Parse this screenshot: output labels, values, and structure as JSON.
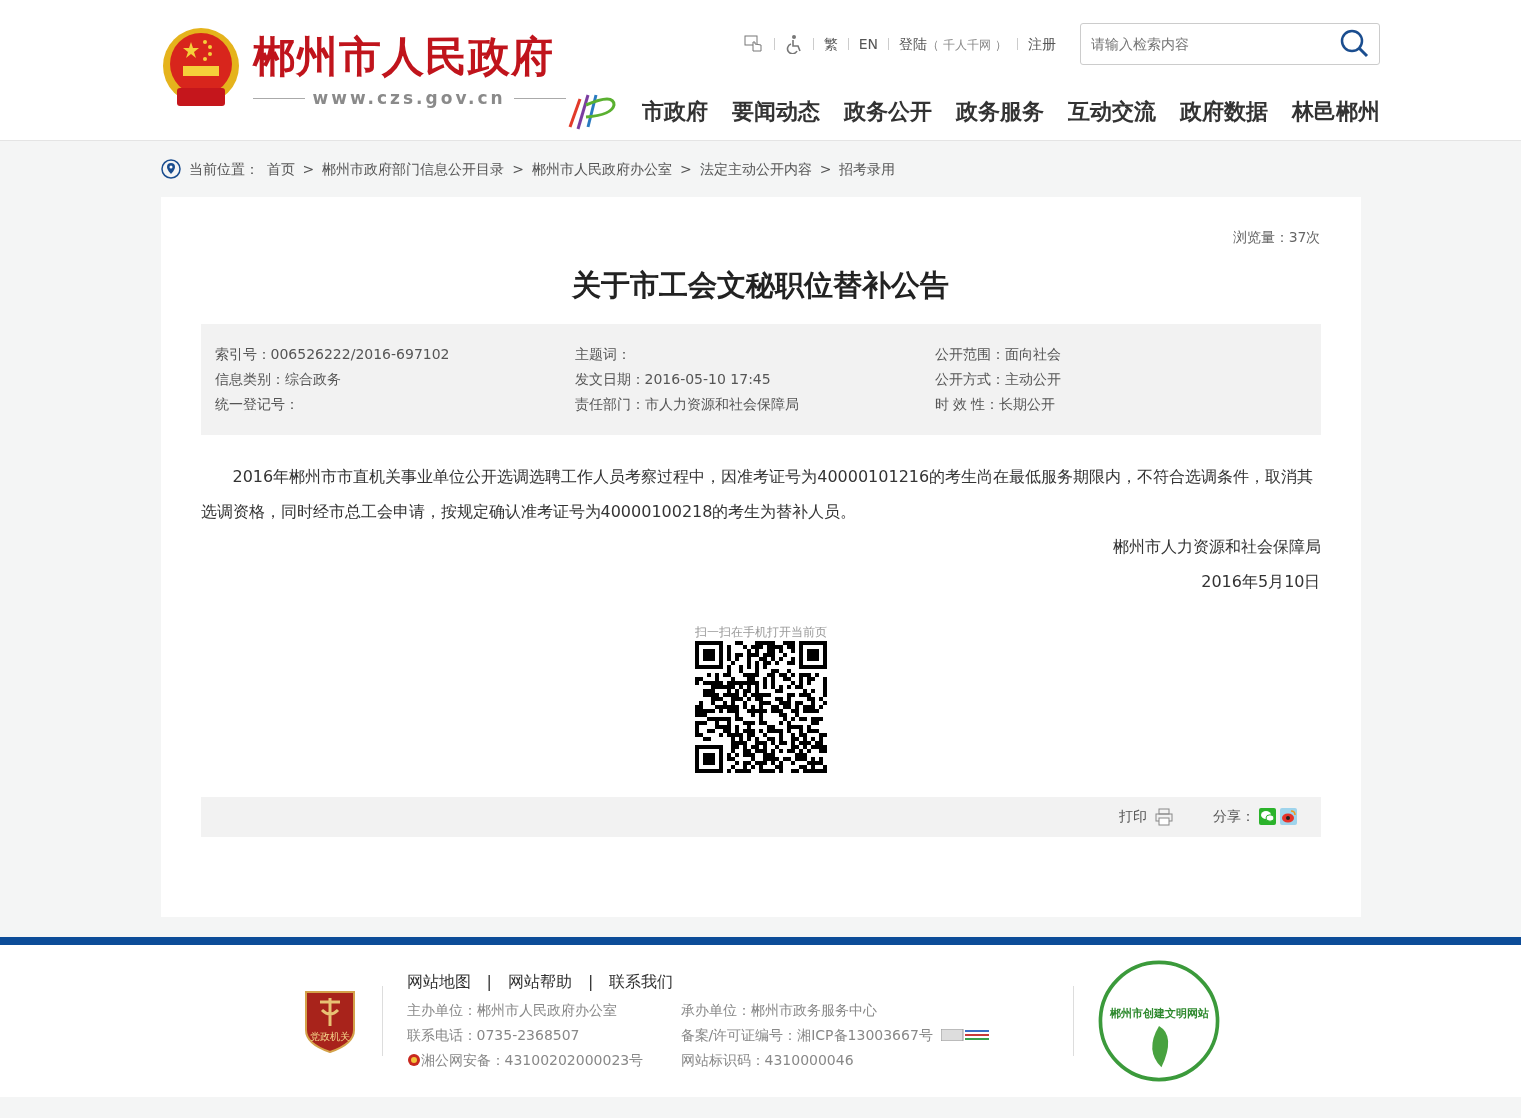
{
  "header": {
    "site_name": "郴州市人民政府",
    "url": "www.czs.gov.cn",
    "top_links": [
      {
        "label": "繁"
      },
      {
        "label": "EN"
      },
      {
        "label": "登陆",
        "note": "（ 千人千网 ）"
      },
      {
        "label": "注册"
      }
    ],
    "search": {
      "placeholder": "请输入检索内容"
    },
    "nav": [
      "市政府",
      "要闻动态",
      "政务公开",
      "政务服务",
      "互动交流",
      "政府数据",
      "林邑郴州"
    ]
  },
  "breadcrumb": {
    "label": "当前位置：",
    "separator": ">",
    "items": [
      "首页",
      "郴州市政府部门信息公开目录",
      "郴州市人民政府办公室",
      "法定主动公开内容",
      "招考录用"
    ]
  },
  "article": {
    "views": "浏览量：37次",
    "title": "关于市工会文秘职位替补公告",
    "meta": [
      "索引号：006526222/2016-697102",
      "主题词：",
      "公开范围：面向社会",
      "信息类别：综合政务",
      "发文日期：2016-05-10 17:45",
      "公开方式：主动公开",
      "统一登记号：",
      "责任部门：市人力资源和社会保障局",
      "时 效 性：长期公开"
    ],
    "body": "2016年郴州市市直机关事业单位公开选调选聘工作人员考察过程中，因准考证号为40000101216的考生尚在最低服务期限内，不符合选调条件，取消其选调资格，同时经市总工会申请，按规定确认准考证号为40000100218的考生为替补人员。",
    "signature": "郴州市人力资源和社会保障局",
    "date": "2016年5月10日",
    "qr_caption": "扫一扫在手机打开当前页",
    "print": "打印",
    "share": "分享："
  },
  "footer": {
    "links": [
      "网站地图",
      "网站帮助",
      "联系我们"
    ],
    "link_separator": "|",
    "badge_text": "党政机关",
    "logo_text": "郴州市创建文明网站",
    "info": [
      {
        "text": "主办单位：郴州市人民政府办公室"
      },
      {
        "text": "承办单位：郴州市政务服务中心"
      },
      {
        "text": "联系电话：0735-2368507"
      },
      {
        "text": "备案/许可证编号：湘ICP备13003667号",
        "kind": "icp"
      },
      {
        "text": "湘公网安备：43100202000023号",
        "kind": "police"
      },
      {
        "text": "网站标识码：4310000046"
      }
    ]
  }
}
